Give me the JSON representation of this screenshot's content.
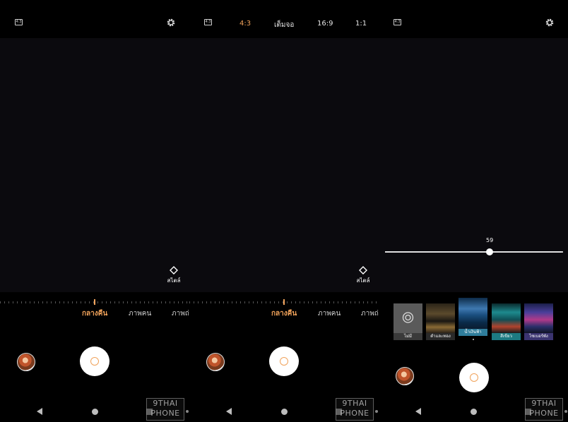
{
  "panels": {
    "left": {
      "ratio_icon": "4:3",
      "style_label": "สไตล์",
      "modes": [
        "กลางคืน",
        "ภาพคน",
        "ภาพถ่"
      ],
      "watermark": [
        "9THAI",
        "PHONE"
      ]
    },
    "middle": {
      "ratio_icon": "4:3",
      "ratio_options": [
        "4:3",
        "เต็มจอ",
        "16:9",
        "1:1"
      ],
      "selected_ratio": "4:3",
      "style_label": "สไตล์",
      "modes": [
        "กลางคืน",
        "ภาพคน",
        "ภาพถ่"
      ],
      "watermark": [
        "9THAI",
        "PHONE"
      ]
    },
    "right": {
      "ratio_icon": "4:3",
      "slider_value": "59",
      "filters": [
        {
          "label": "ไม่มี",
          "selected": false
        },
        {
          "label": "ดำและทอง",
          "selected": false
        },
        {
          "label": "น้ำเงินฟ้า",
          "selected": true
        },
        {
          "label": "สีเขียว",
          "selected": false
        },
        {
          "label": "ไซเบอร์พัง",
          "selected": false
        }
      ],
      "watermark": [
        "9THAI",
        "PHONE"
      ]
    }
  },
  "icons": {
    "settings": "gear-icon",
    "style": "diamond-icon",
    "back": "back-icon",
    "home": "home-icon",
    "recent": "recents-icon"
  },
  "colors": {
    "accent": "#f0a25a",
    "background": "#000000",
    "viewfinder": "#0b0a0e",
    "filter_selected": "#2f7d9b"
  }
}
